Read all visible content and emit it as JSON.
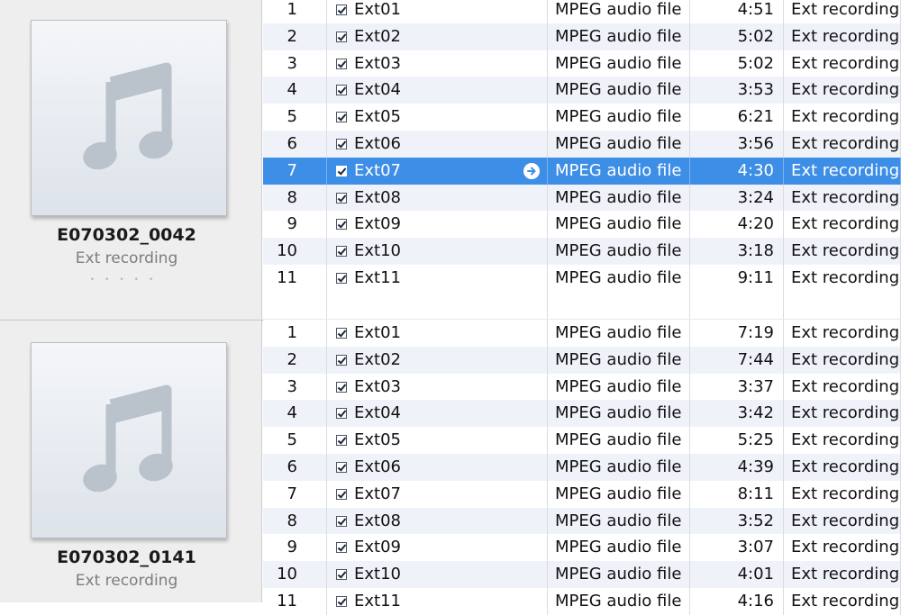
{
  "albums": [
    {
      "title": "E070302_0042",
      "artist": "Ext recording",
      "rating": "•••••",
      "tracks": [
        {
          "num": "1",
          "name": "Ext01",
          "kind": "MPEG audio file",
          "time": "4:51",
          "artist": "Ext recording"
        },
        {
          "num": "2",
          "name": "Ext02",
          "kind": "MPEG audio file",
          "time": "5:02",
          "artist": "Ext recording"
        },
        {
          "num": "3",
          "name": "Ext03",
          "kind": "MPEG audio file",
          "time": "5:02",
          "artist": "Ext recording"
        },
        {
          "num": "4",
          "name": "Ext04",
          "kind": "MPEG audio file",
          "time": "3:53",
          "artist": "Ext recording"
        },
        {
          "num": "5",
          "name": "Ext05",
          "kind": "MPEG audio file",
          "time": "6:21",
          "artist": "Ext recording"
        },
        {
          "num": "6",
          "name": "Ext06",
          "kind": "MPEG audio file",
          "time": "3:56",
          "artist": "Ext recording"
        },
        {
          "num": "7",
          "name": "Ext07",
          "kind": "MPEG audio file",
          "time": "4:30",
          "artist": "Ext recording"
        },
        {
          "num": "8",
          "name": "Ext08",
          "kind": "MPEG audio file",
          "time": "3:24",
          "artist": "Ext recording"
        },
        {
          "num": "9",
          "name": "Ext09",
          "kind": "MPEG audio file",
          "time": "4:20",
          "artist": "Ext recording"
        },
        {
          "num": "10",
          "name": "Ext10",
          "kind": "MPEG audio file",
          "time": "3:18",
          "artist": "Ext recording"
        },
        {
          "num": "11",
          "name": "Ext11",
          "kind": "MPEG audio file",
          "time": "9:11",
          "artist": "Ext recording"
        }
      ]
    },
    {
      "title": "E070302_0141",
      "artist": "Ext recording",
      "tracks": [
        {
          "num": "1",
          "name": "Ext01",
          "kind": "MPEG audio file",
          "time": "7:19",
          "artist": "Ext recording"
        },
        {
          "num": "2",
          "name": "Ext02",
          "kind": "MPEG audio file",
          "time": "7:44",
          "artist": "Ext recording"
        },
        {
          "num": "3",
          "name": "Ext03",
          "kind": "MPEG audio file",
          "time": "3:37",
          "artist": "Ext recording"
        },
        {
          "num": "4",
          "name": "Ext04",
          "kind": "MPEG audio file",
          "time": "3:42",
          "artist": "Ext recording"
        },
        {
          "num": "5",
          "name": "Ext05",
          "kind": "MPEG audio file",
          "time": "5:25",
          "artist": "Ext recording"
        },
        {
          "num": "6",
          "name": "Ext06",
          "kind": "MPEG audio file",
          "time": "4:39",
          "artist": "Ext recording"
        },
        {
          "num": "7",
          "name": "Ext07",
          "kind": "MPEG audio file",
          "time": "8:11",
          "artist": "Ext recording"
        },
        {
          "num": "8",
          "name": "Ext08",
          "kind": "MPEG audio file",
          "time": "3:52",
          "artist": "Ext recording"
        },
        {
          "num": "9",
          "name": "Ext09",
          "kind": "MPEG audio file",
          "time": "3:07",
          "artist": "Ext recording"
        },
        {
          "num": "10",
          "name": "Ext10",
          "kind": "MPEG audio file",
          "time": "4:01",
          "artist": "Ext recording"
        },
        {
          "num": "11",
          "name": "Ext11",
          "kind": "MPEG audio file",
          "time": "4:16",
          "artist": "Ext recording"
        }
      ]
    }
  ],
  "selection": {
    "album": 0,
    "track": 6
  },
  "icons": {
    "artwork": "music-note-icon",
    "checkbox": "checkbox-checked-icon",
    "go": "arrow-right-circle-icon"
  },
  "colors": {
    "selection": "#3d8ee6",
    "row_alt": "#eff3f9",
    "panel": "#eeeeee"
  }
}
